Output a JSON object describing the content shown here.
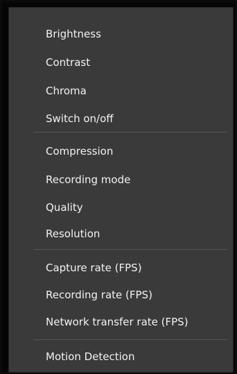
{
  "menu": {
    "groups": [
      {
        "items": [
          {
            "label": "Brightness"
          },
          {
            "label": "Contrast"
          },
          {
            "label": "Chroma"
          },
          {
            "label": "Switch on/off"
          }
        ]
      },
      {
        "items": [
          {
            "label": "Compression"
          },
          {
            "label": "Recording mode"
          },
          {
            "label": "Quality"
          },
          {
            "label": "Resolution"
          }
        ]
      },
      {
        "items": [
          {
            "label": "Capture rate (FPS)"
          },
          {
            "label": "Recording rate (FPS)"
          },
          {
            "label": "Network transfer rate (FPS)"
          }
        ]
      },
      {
        "items": [
          {
            "label": "Motion Detection"
          }
        ]
      }
    ]
  }
}
